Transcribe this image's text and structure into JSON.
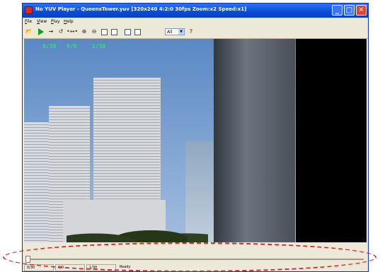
{
  "window": {
    "title": "No YUV Player - QueensTower.yuv [320x240 4:2:0 30fps Zoom:x2 Speed:x1]",
    "controls": {
      "minimize": "_",
      "maximize": "□",
      "close": "✕"
    }
  },
  "menu": [
    "File",
    "View",
    "Play",
    "Help"
  ],
  "toolbar": {
    "icons": [
      "open-icon",
      "play-icon",
      "step-forward-icon",
      "loop-icon",
      "step-range-icon",
      "zoom-in-icon",
      "zoom-out-icon",
      "fit-icon",
      "fullscreen-icon",
      "grid-icon",
      "blank-icon",
      "help-icon"
    ],
    "frame_select_value": "All"
  },
  "video": {
    "overlay": [
      "0/30",
      "0/0",
      "1/30"
    ]
  },
  "seek": {
    "position": 0
  },
  "status": {
    "panes": [
      "0/30",
      "0/0",
      "1/30",
      "Ready"
    ]
  },
  "colors": {
    "overlay_text": "#2fe06a",
    "annotation": "#e02020",
    "title_bar": "#0a4fd8"
  }
}
